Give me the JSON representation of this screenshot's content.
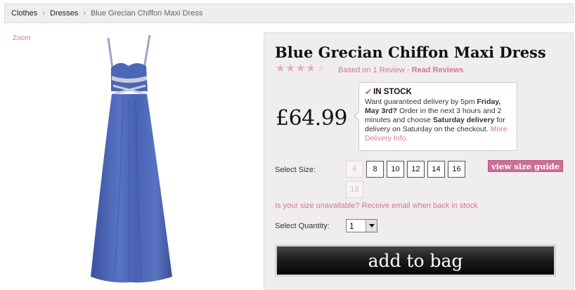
{
  "breadcrumb": {
    "items": [
      "Clothes",
      "Dresses"
    ],
    "separator": "›",
    "current": "Blue Grecian Chiffon Maxi Dress"
  },
  "image": {
    "zoom_label": "Zoom",
    "dress_color": "#4a64b4"
  },
  "product": {
    "title": "Blue Grecian Chiffon Maxi Dress",
    "rating": {
      "filled": 4,
      "total": 5
    },
    "review_prefix": "Based on 1 Review - ",
    "review_link": "Read Reviews",
    "price": "£64.99"
  },
  "stock": {
    "status": "IN STOCK",
    "message_1": "Want guaranteed delivery by 5pm ",
    "bold_1": "Friday, May 3rd?",
    "message_2": " Order in the next 3 hours and 2 minutes and choose ",
    "bold_2": "Saturday delivery",
    "message_3": " for delivery on Saturday on the checkout. ",
    "link": "More Delivery Info."
  },
  "size": {
    "label": "Select Size:",
    "options": [
      {
        "value": "6",
        "available": false
      },
      {
        "value": "8",
        "available": true
      },
      {
        "value": "10",
        "available": true
      },
      {
        "value": "12",
        "available": true
      },
      {
        "value": "14",
        "available": true
      },
      {
        "value": "16",
        "available": true
      },
      {
        "value": "18",
        "available": false
      }
    ],
    "guide_button": "view size guide",
    "unavailable_link": "Is your size unavailable? Receive email when back in stock"
  },
  "quantity": {
    "label": "Select Quantity:",
    "value": "1"
  },
  "cta": {
    "add_to_bag": "add to bag"
  },
  "colors": {
    "accent_pink": "#d2759a",
    "panel_bg": "#f0edee",
    "button_dark": "#111111"
  }
}
